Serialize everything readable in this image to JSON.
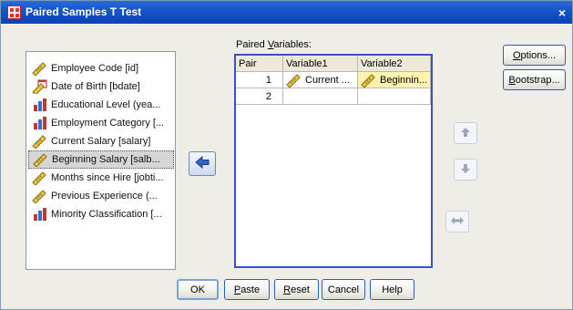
{
  "window": {
    "title": "Paired Samples T Test",
    "close_glyph": "×"
  },
  "source_list": {
    "items": [
      {
        "label": "Employee Code [id]",
        "icon": "ruler-icon",
        "selected": false
      },
      {
        "label": "Date of Birth [bdate]",
        "icon": "ruler-calendar-icon",
        "selected": false
      },
      {
        "label": "Educational Level (yea...",
        "icon": "bar-chart-icon",
        "selected": false
      },
      {
        "label": "Employment Category [...",
        "icon": "bar-chart-icon",
        "selected": false
      },
      {
        "label": "Current Salary [salary]",
        "icon": "ruler-icon",
        "selected": false
      },
      {
        "label": "Beginning Salary [salb...",
        "icon": "ruler-icon",
        "selected": true
      },
      {
        "label": "Months since Hire [jobti...",
        "icon": "ruler-icon",
        "selected": false
      },
      {
        "label": "Previous Experience (...",
        "icon": "ruler-icon",
        "selected": false
      },
      {
        "label": "Minority Classification [...",
        "icon": "bar-chart-icon",
        "selected": false
      }
    ]
  },
  "transfer_button": {
    "icon": "arrow-left-icon"
  },
  "paired_variables": {
    "label_prefix": "Paired ",
    "label_mnemonic": "V",
    "label_suffix": "ariables:",
    "columns": [
      "Pair",
      "Variable1",
      "Variable2"
    ],
    "rows": [
      {
        "pair": "1",
        "variable1": "Current ...",
        "variable2": "Beginnin..."
      },
      {
        "pair": "2",
        "variable1": "",
        "variable2": ""
      }
    ]
  },
  "side_buttons": {
    "up": "arrow-up-icon",
    "down": "arrow-down-icon",
    "swap": "swap-horizontal-icon"
  },
  "right_buttons": {
    "options": {
      "mnemonic": "O",
      "rest": "ptions..."
    },
    "bootstrap": {
      "mnemonic": "B",
      "rest": "ootstrap..."
    }
  },
  "bottom_buttons": {
    "ok": "OK",
    "paste": {
      "mnemonic": "P",
      "rest": "aste"
    },
    "reset": {
      "mnemonic": "R",
      "rest": "eset"
    },
    "cancel": "Cancel",
    "help": "Help"
  },
  "colors": {
    "title_bar": "#1553c9",
    "grid_border": "#3b4fc6",
    "highlight_cell": "#fff3b0",
    "dialog_bg": "#eeede6"
  }
}
